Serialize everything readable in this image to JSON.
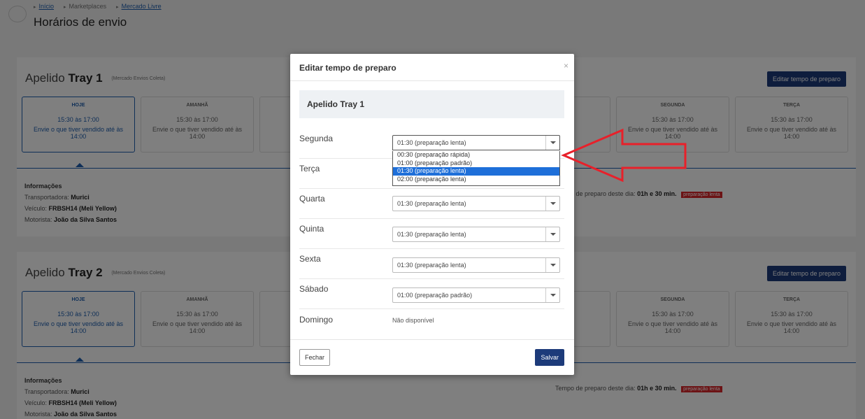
{
  "breadcrumb": [
    "Início",
    "Marketplaces",
    "Mercado Livre"
  ],
  "page_title": "Horários de envio",
  "cards": [
    {
      "name_prefix": "Apelido",
      "name_bold": "Tray 1",
      "service": "(Mercado Envios Coleta)",
      "edit_button": "Editar tempo de preparo",
      "days": [
        {
          "name": "HOJE",
          "time": "15:30 às 17:00",
          "send": "Envie o que tiver vendido até às 14:00"
        },
        {
          "name": "AMANHÃ",
          "time": "15:30 às 17:00",
          "send": "Envie o que tiver vendido até às 14:00"
        },
        {
          "name": "",
          "time": "",
          "send": ""
        },
        {
          "name": "",
          "time": "",
          "send": ""
        },
        {
          "name": "",
          "time": "",
          "send": ""
        },
        {
          "name": "Segunda",
          "time": "15:30 às 17:00",
          "send": "Envie o que tiver vendido até às 14:00"
        },
        {
          "name": "Terça",
          "time": "15:30 às 17:00",
          "send": "Envie o que tiver vendido até às 14:00"
        }
      ],
      "info_title": "Informações",
      "carrier_label": "Transportadora:",
      "carrier": "Murici",
      "vehicle_label": "Veículo:",
      "vehicle": "FRBSH14 (Meli Yellow)",
      "driver_label": "Motorista:",
      "driver": "João da Silva Santos",
      "prep_label": "Tempo de preparo deste dia:",
      "prep_value": "01h e 30 min.",
      "prep_tag": "preparação lenta"
    },
    {
      "name_prefix": "Apelido",
      "name_bold": "Tray 2",
      "service": "(Mercado Envios Coleta)",
      "edit_button": "Editar tempo de preparo",
      "days": [
        {
          "name": "HOJE",
          "time": "15:30 às 17:00",
          "send": "Envie o que tiver vendido até às 14:00"
        },
        {
          "name": "AMANHÃ",
          "time": "15:30 às 17:00",
          "send": "Envie o que tiver vendido até às 14:00"
        },
        {
          "name": "",
          "time": "",
          "send": ""
        },
        {
          "name": "",
          "time": "",
          "send": ""
        },
        {
          "name": "",
          "time": "",
          "send": ""
        },
        {
          "name": "Segunda",
          "time": "15:30 às 17:00",
          "send": "Envie o que tiver vendido até às 14:00"
        },
        {
          "name": "Terça",
          "time": "15:30 às 17:00",
          "send": "Envie o que tiver vendido até às 14:00"
        }
      ],
      "info_title": "Informações",
      "carrier_label": "Transportadora:",
      "carrier": "Murici",
      "vehicle_label": "Veículo:",
      "vehicle": "FRBSH14 (Meli Yellow)",
      "driver_label": "Motorista:",
      "driver": "João da Silva Santos",
      "prep_label": "Tempo de preparo deste dia:",
      "prep_value": "01h e 30 min.",
      "prep_tag": "preparação lenta"
    }
  ],
  "modal": {
    "title": "Editar tempo de preparo",
    "close_glyph": "×",
    "subhead": "Apelido Tray 1",
    "rows": [
      {
        "day": "Segunda",
        "value": "01:30 (preparação lenta)"
      },
      {
        "day": "Terça",
        "value": "01:30 (preparação lenta)"
      },
      {
        "day": "Quarta",
        "value": "01:30 (preparação lenta)"
      },
      {
        "day": "Quinta",
        "value": "01:30 (preparação lenta)"
      },
      {
        "day": "Sexta",
        "value": "01:30 (preparação lenta)"
      },
      {
        "day": "Sábado",
        "value": "01:00 (preparação padrão)"
      },
      {
        "day": "Domingo",
        "value": "Não disponível"
      }
    ],
    "dropdown_options": [
      "00:30 (preparação rápida)",
      "01:00 (preparação padrão)",
      "01:30 (preparação lenta)",
      "02:00 (preparação lenta)"
    ],
    "selected_option": "01:30 (preparação lenta)",
    "close_button": "Fechar",
    "save_button": "Salvar"
  },
  "colors": {
    "accent": "#1d3b7a",
    "link": "#1f5fae",
    "arrow": "#e8202a",
    "highlight": "#1e6fd9"
  }
}
